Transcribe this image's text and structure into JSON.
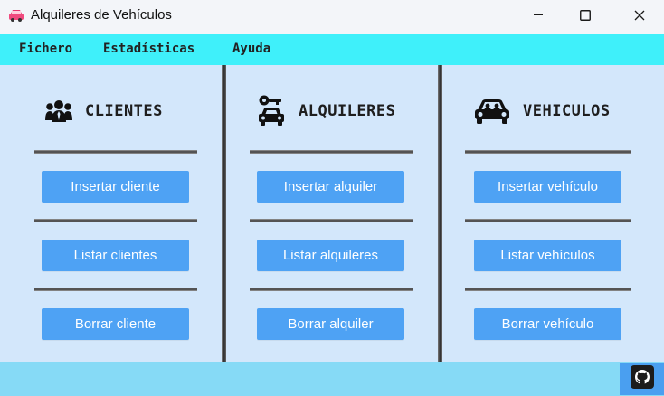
{
  "window": {
    "title": "Alquileres de Vehículos",
    "icon": "car-app-icon",
    "controls": [
      "minimize-icon",
      "maximize-icon",
      "close-icon"
    ]
  },
  "menu": {
    "items": [
      "Fichero",
      "Estadísticas",
      "Ayuda"
    ]
  },
  "columns": [
    {
      "title": "CLIENTES",
      "icon": "people-group-icon",
      "buttons": [
        "Insertar cliente",
        "Listar clientes",
        "Borrar cliente"
      ]
    },
    {
      "title": "ALQUILERES",
      "icon": "car-key-icon",
      "buttons": [
        "Insertar alquiler",
        "Listar alquileres",
        "Borrar alquiler"
      ]
    },
    {
      "title": "VEHICULOS",
      "icon": "car-passengers-icon",
      "buttons": [
        "Insertar vehículo",
        "Listar vehículos",
        "Borrar vehículo"
      ]
    }
  ],
  "footer": {
    "github_icon": "github-icon"
  },
  "colors": {
    "menu_bar": "#3ff0fa",
    "content_bg": "#d3e7fb",
    "button_bg": "#4ea2f4",
    "footer_bg": "#86daf6",
    "github_button_bg": "#4a9ff0"
  }
}
